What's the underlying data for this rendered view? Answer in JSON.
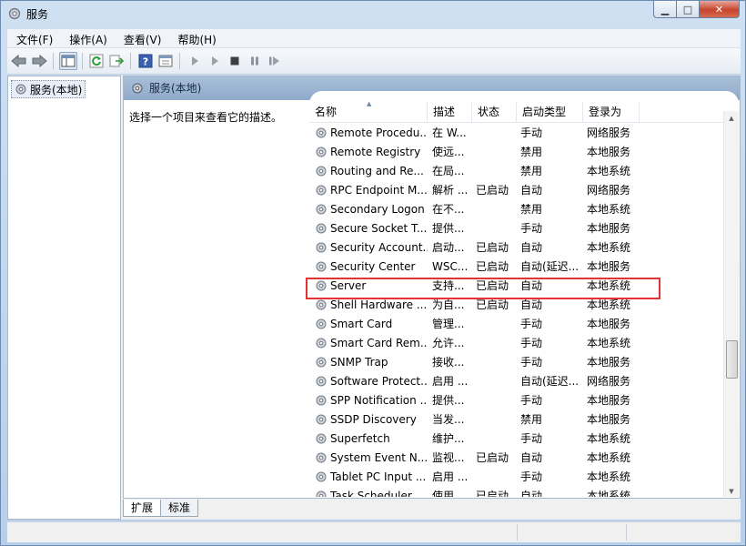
{
  "window": {
    "title": "服务"
  },
  "menu": [
    "文件(F)",
    "操作(A)",
    "查看(V)",
    "帮助(H)"
  ],
  "toolbar": {
    "buttons": [
      "back-icon",
      "forward-icon",
      "show-hide-tree-icon",
      "refresh-icon",
      "export-list-icon",
      "help-icon",
      "properties-icon",
      "start-service-icon",
      "start-service-alt-icon",
      "stop-service-icon",
      "pause-service-icon",
      "restart-service-icon"
    ]
  },
  "tree": {
    "root_label": "服务(本地)"
  },
  "panel": {
    "title": "服务(本地)",
    "description": "选择一个项目来查看它的描述。"
  },
  "columns": [
    "名称",
    "描述",
    "状态",
    "启动类型",
    "登录为"
  ],
  "services": [
    {
      "name": "Remote Procedu...",
      "desc": "在 W...",
      "status": "",
      "startup": "手动",
      "logon": "网络服务"
    },
    {
      "name": "Remote Registry",
      "desc": "使远...",
      "status": "",
      "startup": "禁用",
      "logon": "本地服务"
    },
    {
      "name": "Routing and Re...",
      "desc": "在局...",
      "status": "",
      "startup": "禁用",
      "logon": "本地系统"
    },
    {
      "name": "RPC Endpoint M...",
      "desc": "解析 ...",
      "status": "已启动",
      "startup": "自动",
      "logon": "网络服务"
    },
    {
      "name": "Secondary Logon",
      "desc": "在不...",
      "status": "",
      "startup": "禁用",
      "logon": "本地系统"
    },
    {
      "name": "Secure Socket T...",
      "desc": "提供...",
      "status": "",
      "startup": "手动",
      "logon": "本地服务"
    },
    {
      "name": "Security Account...",
      "desc": "启动...",
      "status": "已启动",
      "startup": "自动",
      "logon": "本地系统"
    },
    {
      "name": "Security Center",
      "desc": "WSC...",
      "status": "已启动",
      "startup": "自动(延迟...",
      "logon": "本地服务"
    },
    {
      "name": "Server",
      "desc": "支持...",
      "status": "已启动",
      "startup": "自动",
      "logon": "本地系统"
    },
    {
      "name": "Shell Hardware ...",
      "desc": "为自...",
      "status": "已启动",
      "startup": "自动",
      "logon": "本地系统"
    },
    {
      "name": "Smart Card",
      "desc": "管理...",
      "status": "",
      "startup": "手动",
      "logon": "本地服务"
    },
    {
      "name": "Smart Card Rem...",
      "desc": "允许...",
      "status": "",
      "startup": "手动",
      "logon": "本地系统"
    },
    {
      "name": "SNMP Trap",
      "desc": "接收...",
      "status": "",
      "startup": "手动",
      "logon": "本地服务"
    },
    {
      "name": "Software Protect...",
      "desc": "启用 ...",
      "status": "",
      "startup": "自动(延迟...",
      "logon": "网络服务"
    },
    {
      "name": "SPP Notification ...",
      "desc": "提供...",
      "status": "",
      "startup": "手动",
      "logon": "本地服务"
    },
    {
      "name": "SSDP Discovery",
      "desc": "当发...",
      "status": "",
      "startup": "禁用",
      "logon": "本地服务"
    },
    {
      "name": "Superfetch",
      "desc": "维护...",
      "status": "",
      "startup": "手动",
      "logon": "本地系统"
    },
    {
      "name": "System Event N...",
      "desc": "监视...",
      "status": "已启动",
      "startup": "自动",
      "logon": "本地系统"
    },
    {
      "name": "Tablet PC Input ...",
      "desc": "启用 ...",
      "status": "",
      "startup": "手动",
      "logon": "本地系统"
    },
    {
      "name": "Task Scheduler",
      "desc": "使用...",
      "status": "已启动",
      "startup": "自动",
      "logon": "本地系统"
    }
  ],
  "tabs": [
    "扩展",
    "标准"
  ],
  "colors": {
    "highlight_border": "#e53333",
    "header_band": "#9ab3d1"
  }
}
